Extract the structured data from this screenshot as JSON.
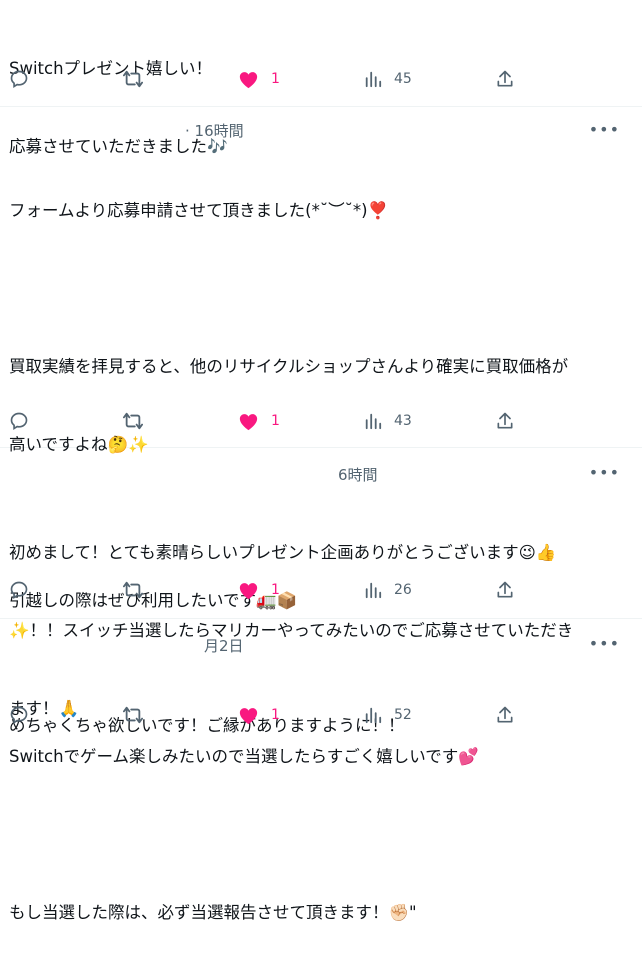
{
  "colors": {
    "like": "#f91880",
    "muted": "#536471",
    "text": "#0f1419",
    "divider": "#eff3f4"
  },
  "posts": [
    {
      "time": "",
      "lines": [
        "Switchプレゼント嬉しい！",
        "応募させていただきました🎶"
      ],
      "likes": "1",
      "views": "45"
    },
    {
      "time": "· 16時間",
      "lines": [
        "フォームより応募申請させて頂きました(*˘︶˘*)❣️",
        "",
        "買取実績を拝見すると、他のリサイクルショップさんより確実に買取価格が",
        "高いですよね🤔✨",
        "",
        "引越しの際はぜひ利用したいです🚛📦",
        "",
        "Switchでゲーム楽しみたいので当選したらすごく嬉しいです💕",
        "",
        "もし当選した際は、必ず当選報告させて頂きます！✊🏻\""
      ],
      "likes": "1",
      "views": "43"
    },
    {
      "time": "6時間",
      "lines": [
        "初めまして！とても素晴らしいプレゼント企画ありがとうございます😉👍",
        "✨！！スイッチ当選したらマリカーやってみたいのでご応募させていただき",
        "ます！🙏"
      ],
      "likes": "1",
      "views": "26"
    },
    {
      "time": "月2日",
      "lines": [
        "めちゃくちゃ欲しいです！ご縁がありますように！！"
      ],
      "likes": "1",
      "views": "52"
    }
  ],
  "icons": {
    "reply": "reply-icon",
    "repost": "repost-icon",
    "like": "heart-icon",
    "views": "views-icon",
    "share": "share-icon",
    "more": "more-icon"
  }
}
